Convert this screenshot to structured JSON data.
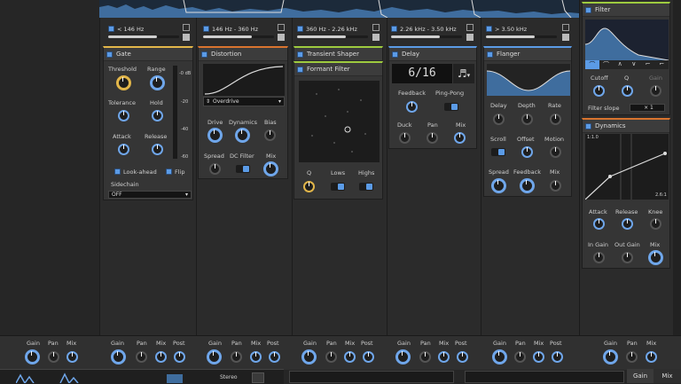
{
  "bands": [
    {
      "label": "< 146 Hz"
    },
    {
      "label": "146 Hz - 360 Hz"
    },
    {
      "label": "360 Hz - 2.26 kHz"
    },
    {
      "label": "2.26 kHz - 3.50 kHz"
    },
    {
      "label": "> 3.50 kHz"
    }
  ],
  "gate": {
    "title": "Gate",
    "threshold": "Threshold",
    "range": "Range",
    "tolerance": "Tolerance",
    "hold": "Hold",
    "attack": "Attack",
    "release": "Release",
    "lookahead": "Look-ahead",
    "flip": "Flip",
    "sidechain": "Sidechain",
    "sidechain_value": "OFF",
    "meter_labels": [
      "-0 dB",
      "-20",
      "-40",
      "-60"
    ]
  },
  "distortion": {
    "title": "Distortion",
    "mode": "Overdrive",
    "drive": "Drive",
    "dynamics": "Dynamics",
    "bias": "Bias",
    "spread": "Spread",
    "dc_filter": "DC Filter",
    "mix": "Mix"
  },
  "transient": {
    "title": "Transient Shaper"
  },
  "formant": {
    "title": "Formant Filter",
    "q": "Q",
    "lows": "Lows",
    "highs": "Highs"
  },
  "delay": {
    "title": "Delay",
    "time": "6/16",
    "note_icon": "♬",
    "feedback": "Feedback",
    "pingpong": "Ping-Pong",
    "duck": "Duck",
    "pan": "Pan",
    "mix": "Mix"
  },
  "flanger": {
    "title": "Flanger",
    "delay": "Delay",
    "depth": "Depth",
    "rate": "Rate",
    "scroll": "Scroll",
    "offset": "Offset",
    "motion": "Motion",
    "spread": "Spread",
    "feedback": "Feedback",
    "mix": "Mix"
  },
  "filter": {
    "title": "Filter",
    "cutoff": "Cutoff",
    "q": "Q",
    "gain": "Gain",
    "slope_label": "Filter slope",
    "slope_value": "× 1"
  },
  "dynamics": {
    "title": "Dynamics",
    "ratio_top": "1:1.0",
    "ratio_bottom": "2.6:1",
    "attack": "Attack",
    "release": "Release",
    "knee": "Knee",
    "in_gain": "In Gain",
    "out_gain": "Out Gain",
    "mix": "Mix"
  },
  "bottom": {
    "gain": "Gain",
    "pan": "Pan",
    "mix": "Mix",
    "post": "Post",
    "tab_gain": "Gain",
    "tab_mix": "Mix",
    "stereo": "Stereo"
  },
  "colors": {
    "accent": "#5b9be6",
    "yellow": "#e2b64a",
    "orange": "#d9742f",
    "green": "#9ecb3f"
  }
}
